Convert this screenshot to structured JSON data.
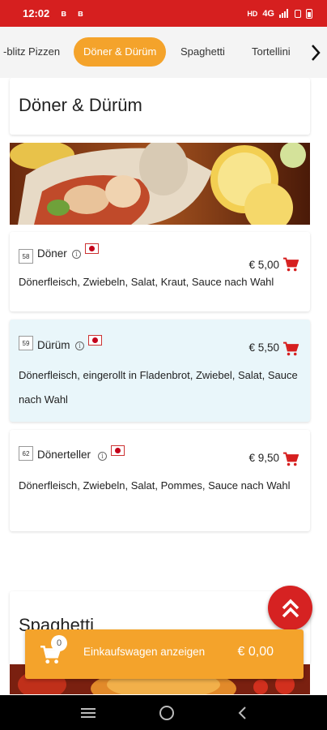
{
  "status_bar": {
    "time": "12:02",
    "network": "4G"
  },
  "categories": {
    "items": [
      {
        "label": "-blitz Pizzen",
        "active": false
      },
      {
        "label": "Döner & Dürüm",
        "active": true
      },
      {
        "label": "Spaghetti",
        "active": false
      },
      {
        "label": "Tortellini",
        "active": false
      }
    ],
    "next_icon": "chevron-right-icon"
  },
  "sections": [
    {
      "title": "Döner & Dürüm",
      "items": [
        {
          "number": "58",
          "name": "Döner",
          "price": "€ 5,00",
          "description": "Dönerfleisch, Zwiebeln, Salat, Kraut, Sauce nach Wahl",
          "highlighted": false
        },
        {
          "number": "59",
          "name": "Dürüm",
          "price": "€ 5,50",
          "description": "Dönerfleisch, eingerollt in Fladenbrot, Zwiebel, Salat, Sauce nach Wahl",
          "highlighted": true
        },
        {
          "number": "62",
          "name": "Dönerteller",
          "price": "€ 9,50",
          "description": "Dönerfleisch, Zwiebeln, Salat, Pommes, Sauce nach Wahl",
          "highlighted": false
        }
      ]
    },
    {
      "title": "Spaghetti",
      "items": []
    }
  ],
  "cart": {
    "count": "0",
    "label": "Einkaufswagen anzeigen",
    "total": "€ 0,00"
  },
  "colors": {
    "status_bar": "#d61f1f",
    "accent": "#f4a32b",
    "cart_icon": "#d61f1f",
    "highlight_row": "#e9f6fa",
    "fab": "#d62222"
  },
  "icons": {
    "info": "info-icon",
    "flag": "flag-icon",
    "cart": "cart-icon",
    "scroll_top": "double-chevron-up-icon"
  }
}
